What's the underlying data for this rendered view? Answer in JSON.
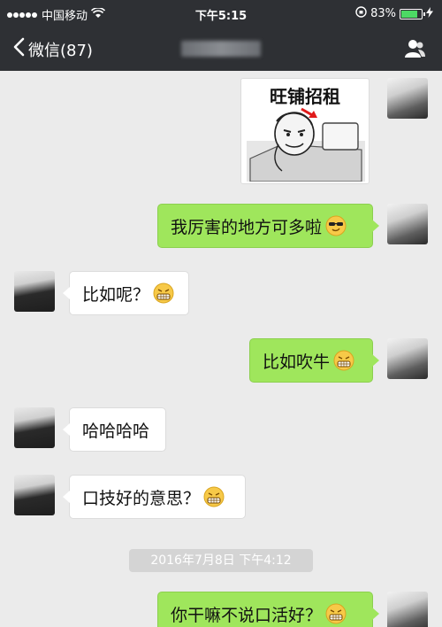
{
  "status_bar": {
    "carrier": "中国移动",
    "time": "下午5:15",
    "battery": "83%",
    "battery_level": 0.83
  },
  "nav": {
    "back_label": "微信(87)",
    "title_hidden": true
  },
  "messages": [
    {
      "side": "out",
      "type": "sticker",
      "text": "旺铺招租"
    },
    {
      "side": "out",
      "type": "text",
      "text": "我厉害的地方可多啦",
      "emoji": "sunglasses"
    },
    {
      "side": "in",
      "type": "text",
      "text": "比如呢？",
      "emoji": "grin"
    },
    {
      "side": "out",
      "type": "text",
      "text": "比如吹牛",
      "emoji": "grin"
    },
    {
      "side": "in",
      "type": "text",
      "text": "哈哈哈哈"
    },
    {
      "side": "in",
      "type": "text",
      "text": "口技好的意思？",
      "emoji": "grin"
    },
    {
      "side": "out",
      "type": "text",
      "text": "你干嘛不说口活好？",
      "emoji": "grin"
    }
  ],
  "timestamp": "2016年7月8日 下午4:12",
  "colors": {
    "header_bg": "#2e3034",
    "outgoing_bubble": "#9fe65c",
    "incoming_bubble": "#ffffff",
    "chat_bg": "#ebebeb"
  }
}
